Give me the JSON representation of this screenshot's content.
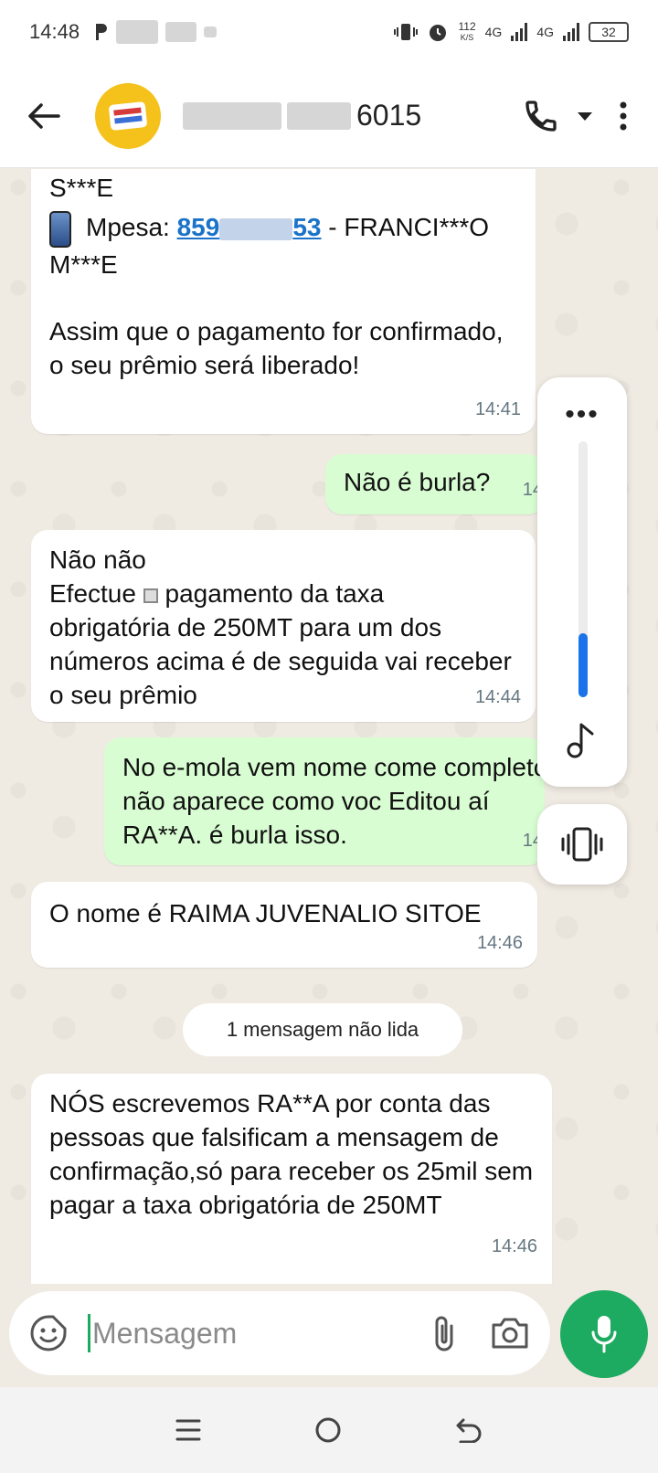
{
  "status_bar": {
    "time": "14:48",
    "net_speed_value": "112",
    "net_speed_unit": "K/S",
    "network_1": "4G",
    "network_2": "4G",
    "battery": "32"
  },
  "header": {
    "contact_suffix": "6015"
  },
  "messages": [
    {
      "direction": "in",
      "line1": "S***E",
      "mpesa_label": "Mpesa:",
      "mpesa_number_start": "859",
      "mpesa_number_end": "53",
      "mpesa_name_part": " - FRANCI***O",
      "line3": "M***E",
      "paragraph": "Assim que o pagamento for confirmado, o seu prêmio será liberado!",
      "time": "14:41"
    },
    {
      "direction": "out",
      "text": "Não é burla?",
      "time": "14"
    },
    {
      "direction": "in",
      "line1": "Não não",
      "line2_a": "Efectue",
      "line2_b": "pagamento da taxa",
      "rest": "obrigatória de 250MT para um dos números acima é de seguida vai receber o seu prêmio",
      "time": "14:44"
    },
    {
      "direction": "out",
      "text": "No e-mola vem nome come completo não aparece como voc Editou aí RA**A. é burla isso.",
      "time": "14"
    },
    {
      "direction": "in",
      "text": "O nome é RAIMA JUVENALIO SITOE",
      "time": "14:46"
    },
    {
      "direction": "in",
      "text": "NÓS escrevemos RA**A por conta das pessoas que falsificam a mensagem de confirmação,só para receber os 25mil sem pagar a taxa obrigatória de 250MT",
      "time": "14:46"
    }
  ],
  "unread_label": "1 mensagem não lida",
  "volume": {
    "dots": "•••",
    "level": 0.25
  },
  "composer": {
    "placeholder": "Mensagem"
  }
}
